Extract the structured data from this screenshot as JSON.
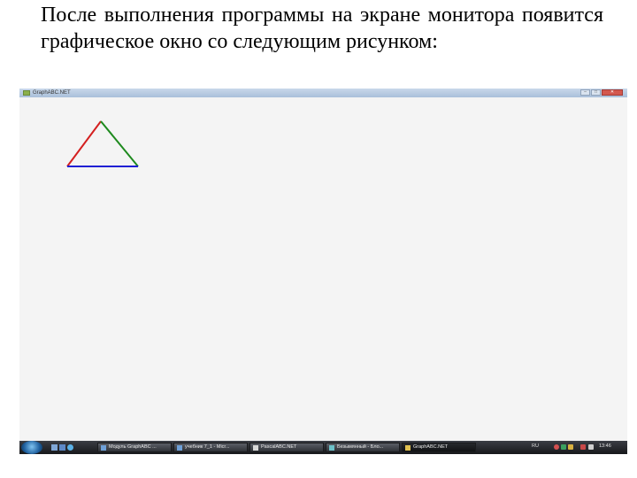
{
  "paragraph": {
    "text": "После  выполнения программы на экране монитора появится графическое окно со следующим рисунком:"
  },
  "window": {
    "title": "GraphABC.NET",
    "buttons": {
      "minimize": "–",
      "maximize": "□",
      "close": "✕"
    }
  },
  "drawing": {
    "shape": "triangle",
    "sides": [
      {
        "name": "left",
        "color": "#d42020"
      },
      {
        "name": "right",
        "color": "#1e8a1e"
      },
      {
        "name": "base",
        "color": "#2020d4"
      }
    ]
  },
  "taskbar": {
    "start_icon": "windows-start-icon",
    "quicklaunch": [
      "show-desktop-icon",
      "switch-windows-icon",
      "internet-explorer-icon"
    ],
    "buttons": [
      {
        "label": "Модуль GraphABC ..."
      },
      {
        "label": "учебник 7_1 - Micr..."
      },
      {
        "label": "PascalABC.NET"
      },
      {
        "label": "Безымянный - Бло..."
      },
      {
        "label": "GraphABC.NET",
        "active": true
      }
    ],
    "language": "RU",
    "clock": "13:46"
  }
}
